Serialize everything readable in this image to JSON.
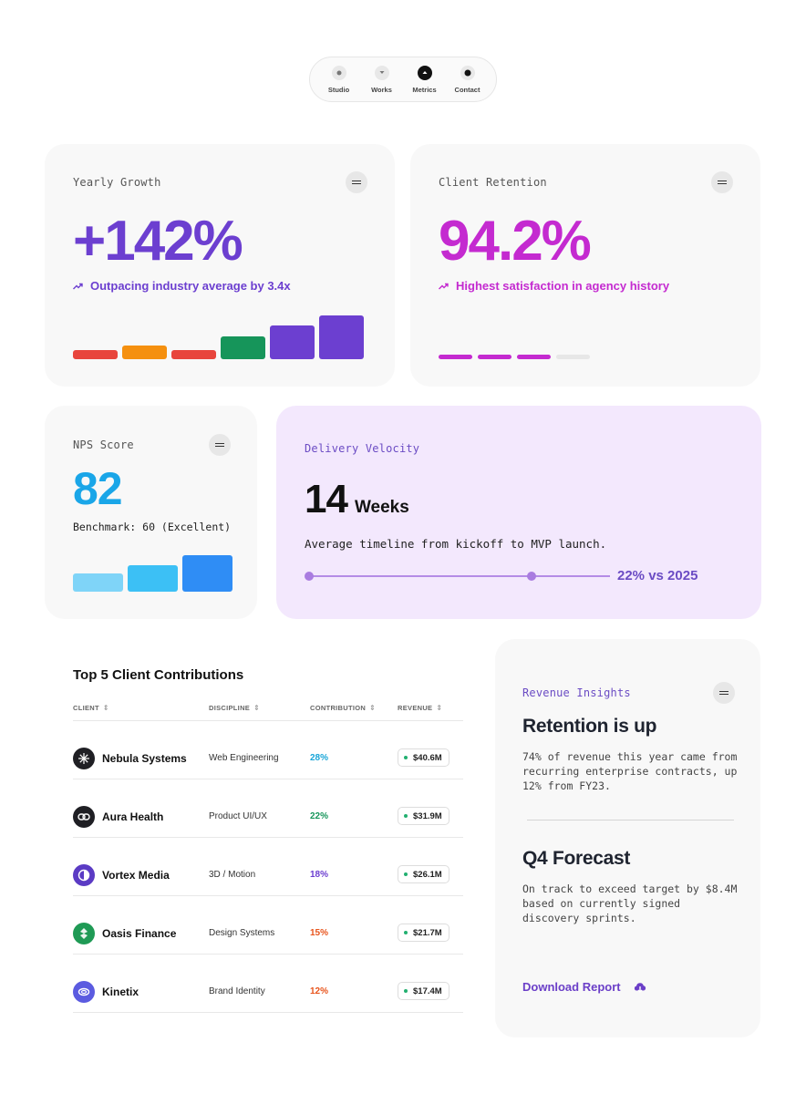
{
  "nav": {
    "items": [
      {
        "label": "Studio"
      },
      {
        "label": "Works"
      },
      {
        "label": "Metrics",
        "active": true
      },
      {
        "label": "Contact"
      }
    ]
  },
  "growth": {
    "label": "Yearly Growth",
    "value": "+142%",
    "trend": "Outpacing industry average by 3.4x",
    "color": "#6c3fd0",
    "bars": [
      {
        "level": 0.2,
        "color": "#e8453c"
      },
      {
        "level": 0.32,
        "color": "#f5900f"
      },
      {
        "level": 0.2,
        "color": "#e8453c"
      },
      {
        "level": 0.53,
        "color": "#16955a"
      },
      {
        "level": 0.77,
        "color": "#6c3fd0"
      },
      {
        "level": 1.0,
        "color": "#6c3fd0"
      }
    ]
  },
  "retention": {
    "label": "Client Retention",
    "value": "94.2%",
    "trend": "Highest satisfaction in agency history",
    "color": "#c42ad0",
    "segments_filled": 3,
    "segments_total": 4
  },
  "nps": {
    "label": "NPS Score",
    "value": "82",
    "benchmark": "Benchmark: 60 (Excellent)",
    "color": "#1aa6e8",
    "bars": [
      {
        "level": 0.5,
        "color": "#7fd4f8"
      },
      {
        "level": 0.73,
        "color": "#3cc0f5"
      },
      {
        "level": 1.0,
        "color": "#2f8df5"
      }
    ]
  },
  "velocity": {
    "label": "Delivery Velocity",
    "number": "14",
    "unit": "Weeks",
    "description": "Average timeline from kickoff to MVP launch.",
    "comparison": "22% vs 2025",
    "slider_level": 0.74
  },
  "table": {
    "title": "Top 5 Client Contributions",
    "headers": [
      "CLIENT",
      "DISCIPLINE",
      "CONTRIBUTION",
      "REVENUE"
    ],
    "rows": [
      {
        "client": "Nebula Systems",
        "discipline": "Web Engineering",
        "contribution": "28%",
        "revenue": "$40.6M",
        "contrib_color": "#1aa6d8",
        "avatar_color": "#1f1f24",
        "icon": "starburst-icon"
      },
      {
        "client": "Aura Health",
        "discipline": "Product UI/UX",
        "contribution": "22%",
        "revenue": "$31.9M",
        "contrib_color": "#16955a",
        "avatar_color": "#1f1f24",
        "icon": "link-icon"
      },
      {
        "client": "Vortex Media",
        "discipline": "3D / Motion",
        "contribution": "18%",
        "revenue": "$26.1M",
        "contrib_color": "#6c3fd0",
        "avatar_color": "#5b3bc4",
        "icon": "half-circle-icon"
      },
      {
        "client": "Oasis Finance",
        "discipline": "Design Systems",
        "contribution": "15%",
        "revenue": "$21.7M",
        "contrib_color": "#e8541c",
        "avatar_color": "#1f9a55",
        "icon": "leaf-icon"
      },
      {
        "client": "Kinetix",
        "discipline": "Brand Identity",
        "contribution": "12%",
        "revenue": "$17.4M",
        "contrib_color": "#e8541c",
        "avatar_color": "#5b5be0",
        "icon": "loop-icon"
      }
    ]
  },
  "insights": {
    "label": "Revenue Insights",
    "heading1": "Retention is up",
    "text1": "74% of revenue this year came from recurring enterprise contracts, up 12% from FY23.",
    "heading2": "Q4 Forecast",
    "text2": "On track to exceed target by $8.4M based on currently signed discovery sprints.",
    "download": "Download Report"
  }
}
